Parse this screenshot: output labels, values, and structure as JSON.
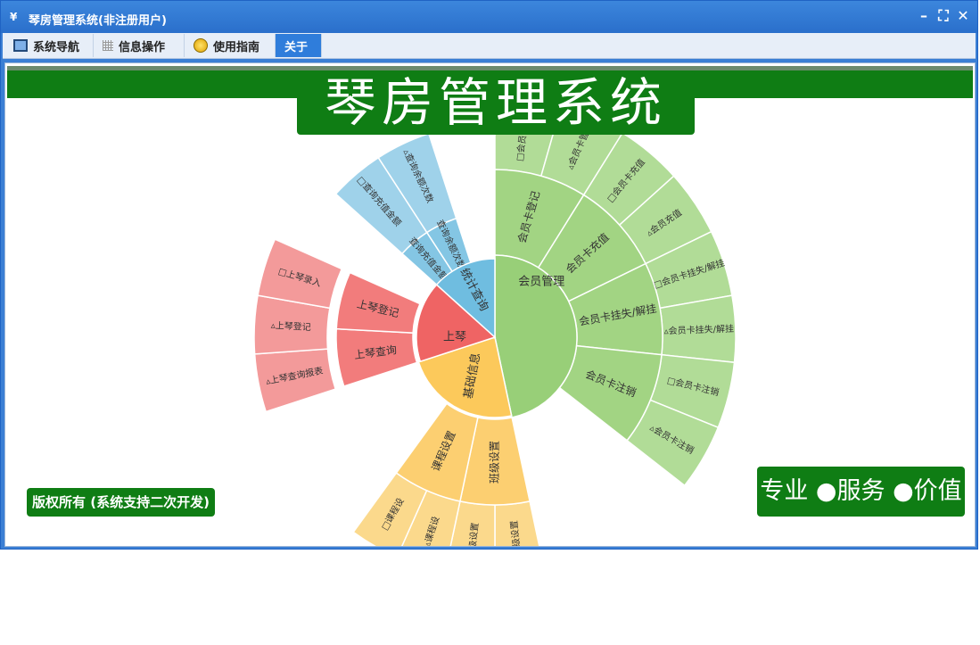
{
  "window": {
    "title": "琴房管理系统(非注册用户)",
    "app_icon": "¥"
  },
  "tabs": [
    {
      "label": "系统导航",
      "icon": "monitor-icon"
    },
    {
      "label": "信息操作",
      "icon": "grid-icon"
    },
    {
      "label": "使用指南",
      "icon": "help-circle-icon"
    },
    {
      "label": "关于",
      "icon": ""
    }
  ],
  "banner": {
    "title": "琴房管理系统"
  },
  "footer": {
    "copyright": "版权所有 (系统支持二次开发)",
    "slogan": "专业 ●服务 ●价值"
  },
  "sunburst": {
    "center": [
      {
        "label": "会员管理",
        "color": "#98cf78"
      },
      {
        "label": "基础信息",
        "color": "#fcc95b"
      },
      {
        "label": "上琴",
        "color": "#ef6464"
      },
      {
        "label": "统计查询",
        "color": "#6fbde0"
      }
    ],
    "groups": {
      "member": [
        "会员卡登记",
        "会员卡充值",
        "会员卡挂失/解挂",
        "会员卡注销"
      ],
      "member_leaves": [
        "□会员卡注册",
        "▵会员卡管",
        "□会员卡充值",
        "▵会员充值",
        "□会员卡挂失/解挂",
        "▵会员卡挂失/解挂",
        "□会员卡注销",
        "▵会员卡注销"
      ],
      "basic": [
        "班级设置",
        "课程设置"
      ],
      "basic_leaves": [
        "▵班级设置",
        "班级设置",
        "▵课程设",
        "□课程设"
      ],
      "piano": [
        "上琴查询",
        "上琴登记"
      ],
      "piano_leaves": [
        "▵上琴查询报表",
        "▵上琴登记",
        "□上琴录入"
      ],
      "stats": [
        "查询充值金额",
        "查询余额次数"
      ],
      "stats_leaves": [
        "□查询充值金额",
        "▵查询余额次数"
      ]
    }
  }
}
